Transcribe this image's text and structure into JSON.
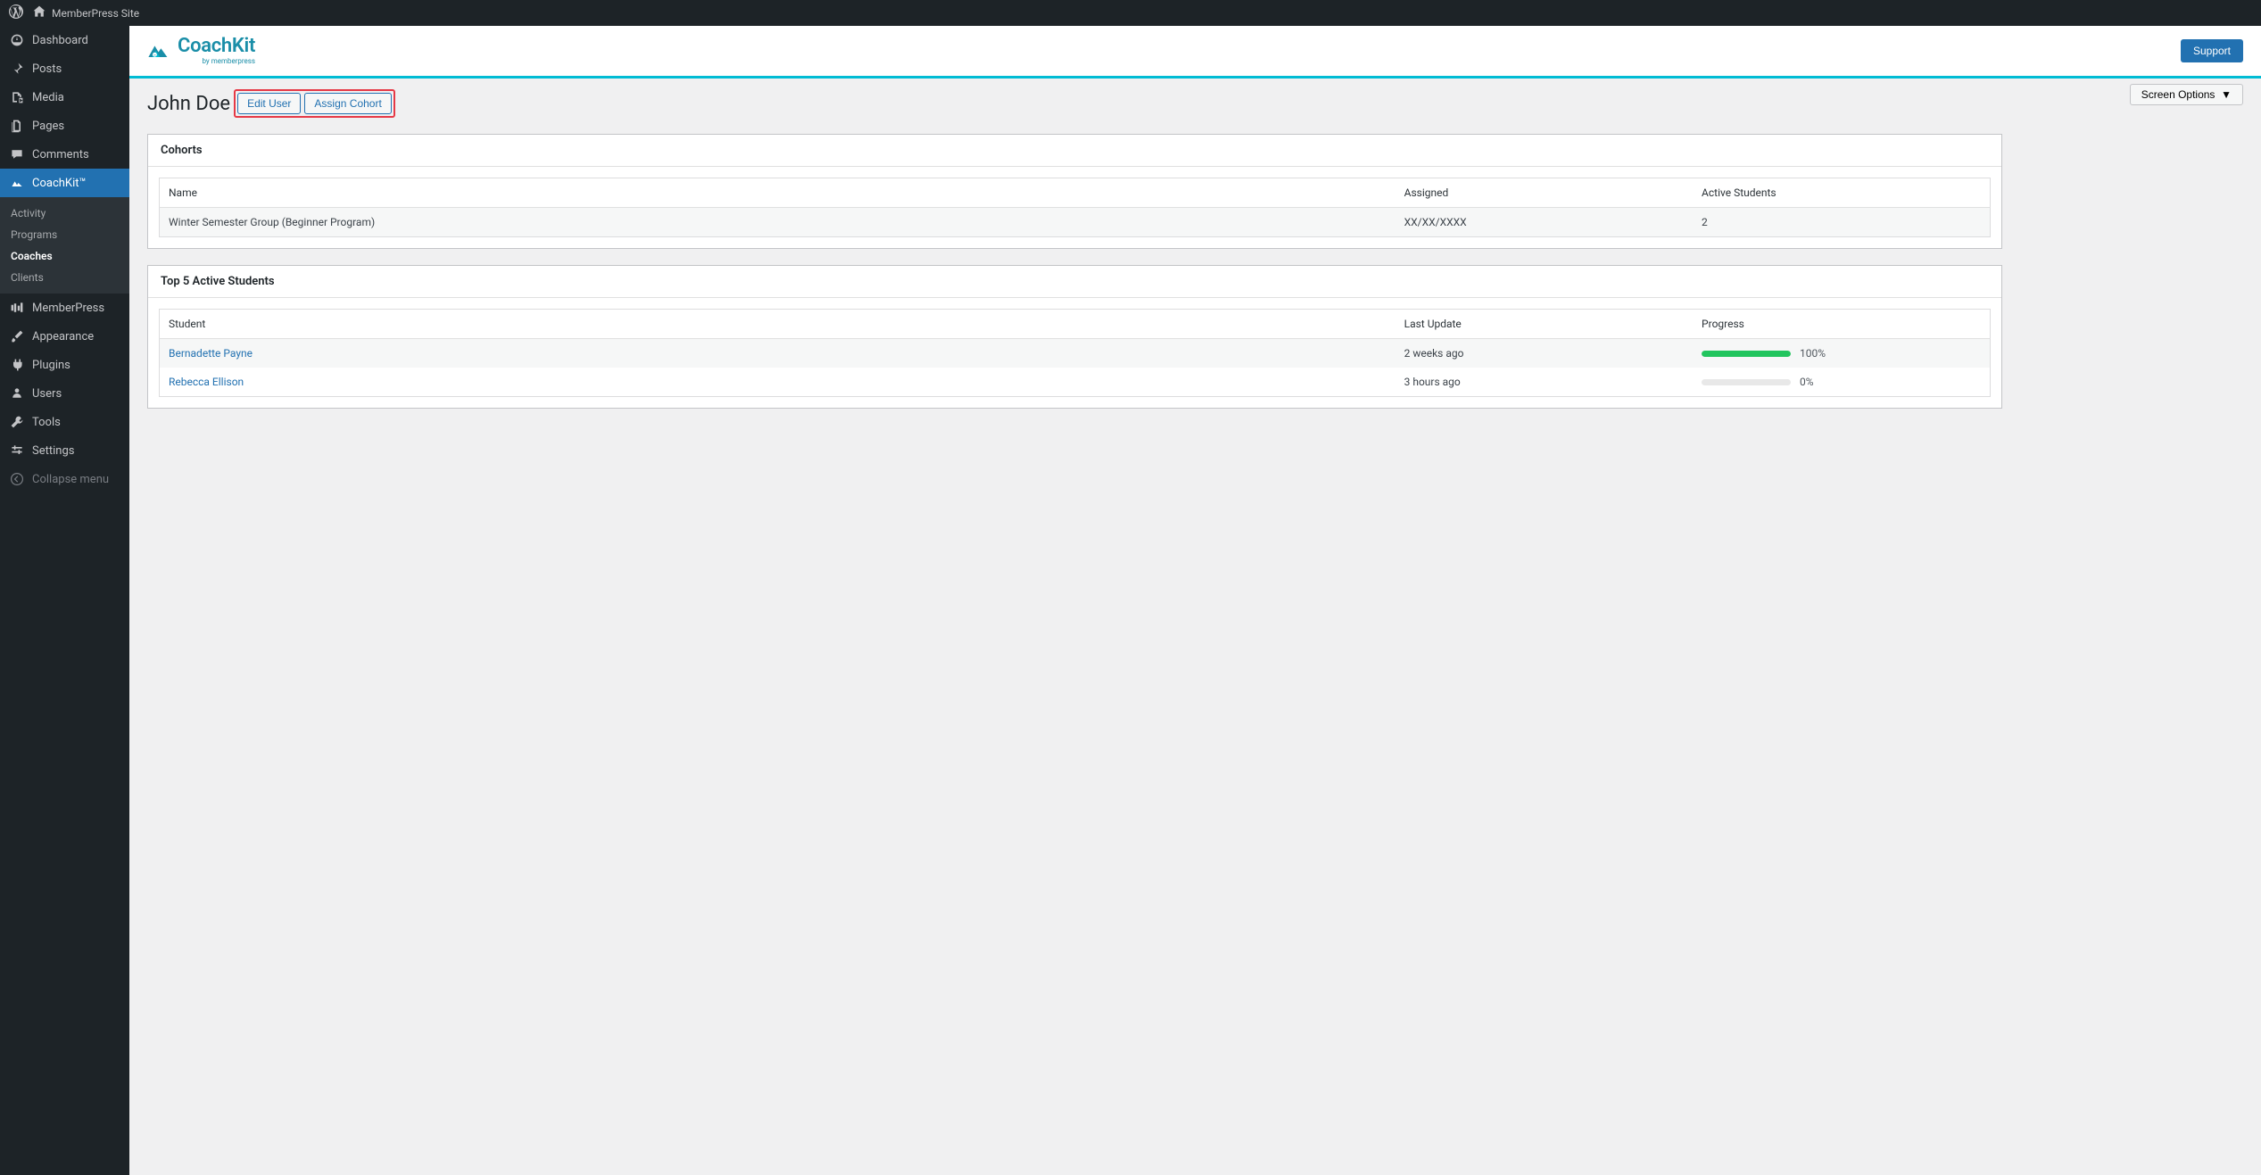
{
  "adminbar": {
    "site_name": "MemberPress Site"
  },
  "sidebar": {
    "items": [
      {
        "label": "Dashboard"
      },
      {
        "label": "Posts"
      },
      {
        "label": "Media"
      },
      {
        "label": "Pages"
      },
      {
        "label": "Comments"
      },
      {
        "label": "CoachKit™"
      },
      {
        "label": "MemberPress"
      },
      {
        "label": "Appearance"
      },
      {
        "label": "Plugins"
      },
      {
        "label": "Users"
      },
      {
        "label": "Tools"
      },
      {
        "label": "Settings"
      },
      {
        "label": "Collapse menu"
      }
    ],
    "submenu": [
      {
        "label": "Activity"
      },
      {
        "label": "Programs"
      },
      {
        "label": "Coaches"
      },
      {
        "label": "Clients"
      }
    ]
  },
  "header": {
    "brand_name": "CoachKit",
    "brand_sub": "by memberpress",
    "support_label": "Support"
  },
  "page": {
    "screen_options_label": "Screen Options",
    "title": "John Doe",
    "edit_user_label": "Edit User",
    "assign_cohort_label": "Assign Cohort"
  },
  "cohorts_panel": {
    "title": "Cohorts",
    "headers": {
      "name": "Name",
      "assigned": "Assigned",
      "active": "Active Students"
    },
    "rows": [
      {
        "name": "Winter Semester Group (Beginner Program)",
        "assigned": "XX/XX/XXXX",
        "active": "2"
      }
    ]
  },
  "students_panel": {
    "title": "Top 5 Active Students",
    "headers": {
      "student": "Student",
      "last_update": "Last Update",
      "progress": "Progress"
    },
    "rows": [
      {
        "student": "Bernadette Payne",
        "last_update": "2 weeks ago",
        "progress_pct": 100,
        "progress_label": "100%"
      },
      {
        "student": "Rebecca Ellison",
        "last_update": "3 hours ago",
        "progress_pct": 0,
        "progress_label": "0%"
      }
    ]
  }
}
